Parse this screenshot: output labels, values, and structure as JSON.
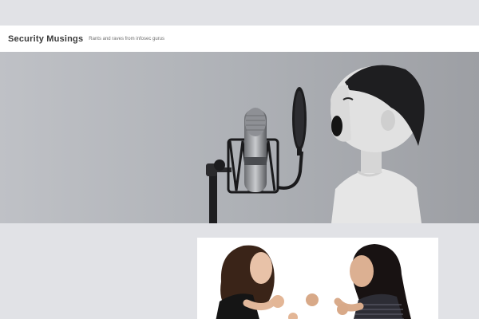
{
  "site": {
    "title": "Security Musings",
    "tagline": "Rants and raves from infosec gurus"
  },
  "hero": {
    "image": "boy-shouting-into-studio-microphone"
  },
  "featured_post": {
    "image": "two-women-arguing-fists-raised"
  },
  "colors": {
    "page_background": "#e1e2e6",
    "header_background": "#ffffff",
    "title_color": "#3b3b3b"
  }
}
